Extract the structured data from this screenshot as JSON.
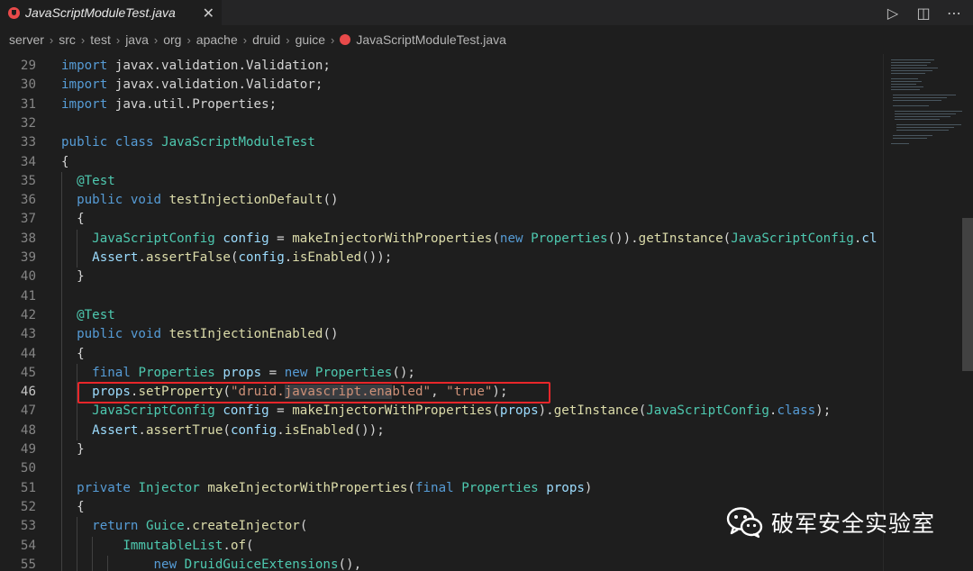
{
  "tab": {
    "title": "JavaScriptModuleTest.java",
    "close_glyph": "✕",
    "icon": "java-file-icon"
  },
  "toolbar": {
    "run_glyph": "▷",
    "split_glyph": "◫",
    "more_glyph": "⋯"
  },
  "breadcrumb": [
    "server",
    "src",
    "test",
    "java",
    "org",
    "apache",
    "druid",
    "guice",
    "JavaScriptModuleTest.java"
  ],
  "breadcrumb_sep": "›",
  "editor": {
    "active_line": 46,
    "highlighted_line": 46,
    "lines": [
      {
        "n": "29",
        "tokens": [
          [
            "k",
            "import"
          ],
          [
            "p",
            " javax.validation.Validation;"
          ]
        ]
      },
      {
        "n": "30",
        "tokens": [
          [
            "k",
            "import"
          ],
          [
            "p",
            " javax.validation.Validator;"
          ]
        ]
      },
      {
        "n": "31",
        "tokens": [
          [
            "k",
            "import"
          ],
          [
            "p",
            " java.util.Properties;"
          ]
        ]
      },
      {
        "n": "32",
        "tokens": []
      },
      {
        "n": "33",
        "tokens": [
          [
            "k",
            "public"
          ],
          [
            "p",
            " "
          ],
          [
            "k",
            "class"
          ],
          [
            "p",
            " "
          ],
          [
            "t",
            "JavaScriptModuleTest"
          ]
        ]
      },
      {
        "n": "34",
        "tokens": [
          [
            "p",
            "{"
          ]
        ]
      },
      {
        "n": "35",
        "tokens": [
          [
            "p",
            "  "
          ],
          [
            "t",
            "@Test"
          ]
        ]
      },
      {
        "n": "36",
        "tokens": [
          [
            "p",
            "  "
          ],
          [
            "k",
            "public"
          ],
          [
            "p",
            " "
          ],
          [
            "k",
            "void"
          ],
          [
            "p",
            " "
          ],
          [
            "f",
            "testInjectionDefault"
          ],
          [
            "p",
            "()"
          ]
        ]
      },
      {
        "n": "37",
        "tokens": [
          [
            "p",
            "  {"
          ]
        ]
      },
      {
        "n": "38",
        "tokens": [
          [
            "p",
            "    "
          ],
          [
            "t",
            "JavaScriptConfig"
          ],
          [
            "p",
            " "
          ],
          [
            "v",
            "config"
          ],
          [
            "p",
            " = "
          ],
          [
            "f",
            "makeInjectorWithProperties"
          ],
          [
            "p",
            "("
          ],
          [
            "k",
            "new"
          ],
          [
            "p",
            " "
          ],
          [
            "t",
            "Properties"
          ],
          [
            "p",
            "())."
          ],
          [
            "f",
            "getInstance"
          ],
          [
            "p",
            "("
          ],
          [
            "t",
            "JavaScriptConfig"
          ],
          [
            "p",
            "."
          ],
          [
            "v",
            "cl"
          ]
        ]
      },
      {
        "n": "39",
        "tokens": [
          [
            "p",
            "    "
          ],
          [
            "v",
            "Assert"
          ],
          [
            "p",
            "."
          ],
          [
            "f",
            "assertFalse"
          ],
          [
            "p",
            "("
          ],
          [
            "v",
            "config"
          ],
          [
            "p",
            "."
          ],
          [
            "f",
            "isEnabled"
          ],
          [
            "p",
            "());"
          ]
        ]
      },
      {
        "n": "40",
        "tokens": [
          [
            "p",
            "  }"
          ]
        ]
      },
      {
        "n": "41",
        "tokens": []
      },
      {
        "n": "42",
        "tokens": [
          [
            "p",
            "  "
          ],
          [
            "t",
            "@Test"
          ]
        ]
      },
      {
        "n": "43",
        "tokens": [
          [
            "p",
            "  "
          ],
          [
            "k",
            "public"
          ],
          [
            "p",
            " "
          ],
          [
            "k",
            "void"
          ],
          [
            "p",
            " "
          ],
          [
            "f",
            "testInjectionEnabled"
          ],
          [
            "p",
            "()"
          ]
        ]
      },
      {
        "n": "44",
        "tokens": [
          [
            "p",
            "  {"
          ]
        ]
      },
      {
        "n": "45",
        "tokens": [
          [
            "p",
            "    "
          ],
          [
            "k",
            "final"
          ],
          [
            "p",
            " "
          ],
          [
            "t",
            "Properties"
          ],
          [
            "p",
            " "
          ],
          [
            "v",
            "props"
          ],
          [
            "p",
            " = "
          ],
          [
            "k",
            "new"
          ],
          [
            "p",
            " "
          ],
          [
            "t",
            "Properties"
          ],
          [
            "p",
            "();"
          ]
        ]
      },
      {
        "n": "46",
        "tokens": [
          [
            "p",
            "    "
          ],
          [
            "v",
            "props"
          ],
          [
            "p",
            "."
          ],
          [
            "f",
            "setProperty"
          ],
          [
            "p",
            "("
          ],
          [
            "s",
            "\"druid."
          ],
          [
            "sel",
            "javascript.ena"
          ],
          [
            "s",
            "bled\""
          ],
          [
            "p",
            ", "
          ],
          [
            "s",
            "\"true\""
          ],
          [
            "p",
            ");"
          ]
        ]
      },
      {
        "n": "47",
        "tokens": [
          [
            "p",
            "    "
          ],
          [
            "t",
            "JavaScriptConfig"
          ],
          [
            "p",
            " "
          ],
          [
            "v",
            "config"
          ],
          [
            "p",
            " = "
          ],
          [
            "f",
            "makeInjectorWithProperties"
          ],
          [
            "p",
            "("
          ],
          [
            "v",
            "props"
          ],
          [
            "p",
            ")."
          ],
          [
            "f",
            "getInstance"
          ],
          [
            "p",
            "("
          ],
          [
            "t",
            "JavaScriptConfig"
          ],
          [
            "p",
            "."
          ],
          [
            "k",
            "class"
          ],
          [
            "p",
            ");"
          ]
        ]
      },
      {
        "n": "48",
        "tokens": [
          [
            "p",
            "    "
          ],
          [
            "v",
            "Assert"
          ],
          [
            "p",
            "."
          ],
          [
            "f",
            "assertTrue"
          ],
          [
            "p",
            "("
          ],
          [
            "v",
            "config"
          ],
          [
            "p",
            "."
          ],
          [
            "f",
            "isEnabled"
          ],
          [
            "p",
            "());"
          ]
        ]
      },
      {
        "n": "49",
        "tokens": [
          [
            "p",
            "  }"
          ]
        ]
      },
      {
        "n": "50",
        "tokens": []
      },
      {
        "n": "51",
        "tokens": [
          [
            "p",
            "  "
          ],
          [
            "k",
            "private"
          ],
          [
            "p",
            " "
          ],
          [
            "t",
            "Injector"
          ],
          [
            "p",
            " "
          ],
          [
            "f",
            "makeInjectorWithProperties"
          ],
          [
            "p",
            "("
          ],
          [
            "k",
            "final"
          ],
          [
            "p",
            " "
          ],
          [
            "t",
            "Properties"
          ],
          [
            "p",
            " "
          ],
          [
            "v",
            "props"
          ],
          [
            "p",
            ")"
          ]
        ]
      },
      {
        "n": "52",
        "tokens": [
          [
            "p",
            "  {"
          ]
        ]
      },
      {
        "n": "53",
        "tokens": [
          [
            "p",
            "    "
          ],
          [
            "k",
            "return"
          ],
          [
            "p",
            " "
          ],
          [
            "t",
            "Guice"
          ],
          [
            "p",
            "."
          ],
          [
            "f",
            "createInjector"
          ],
          [
            "p",
            "("
          ]
        ]
      },
      {
        "n": "54",
        "tokens": [
          [
            "p",
            "        "
          ],
          [
            "t",
            "ImmutableList"
          ],
          [
            "p",
            "."
          ],
          [
            "f",
            "of"
          ],
          [
            "p",
            "("
          ]
        ]
      },
      {
        "n": "55",
        "tokens": [
          [
            "p",
            "            "
          ],
          [
            "k",
            "new"
          ],
          [
            "p",
            " "
          ],
          [
            "t",
            "DruidGuiceExtensions"
          ],
          [
            "p",
            "(),"
          ]
        ]
      }
    ]
  },
  "watermark": {
    "text": "破军安全实验室",
    "icon": "wechat-icon"
  },
  "colors": {
    "keyword": "#569cd6",
    "type": "#4ec9b0",
    "function": "#dcdcaa",
    "variable": "#9cdcfe",
    "string": "#ce9178",
    "highlight_box": "#e8262a"
  }
}
